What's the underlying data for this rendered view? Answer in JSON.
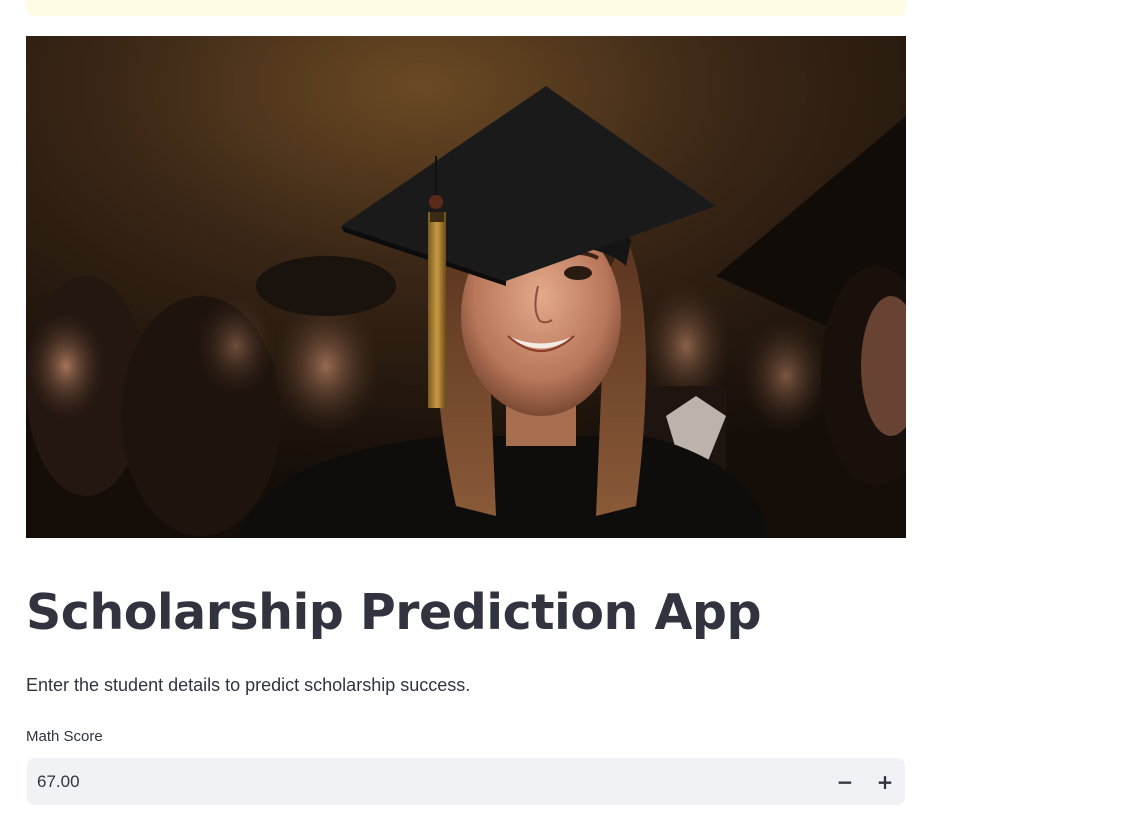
{
  "app": {
    "title": "Scholarship Prediction App",
    "subtitle": "Enter the student details to predict scholarship success."
  },
  "hero_image": {
    "description": "graduate student in cap and gown smiling"
  },
  "form": {
    "math_score": {
      "label": "Math Score",
      "value": "67.00",
      "decrement_label": "−",
      "increment_label": "+"
    }
  },
  "colors": {
    "text": "#31333f",
    "input_bg": "#f0f2f6",
    "alert_bg": "#fffce6"
  }
}
